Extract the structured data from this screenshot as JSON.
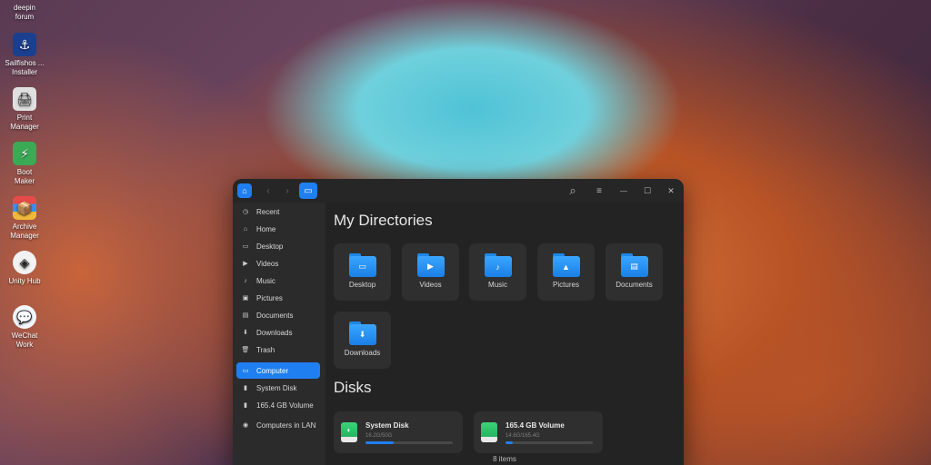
{
  "desktop": {
    "icons": [
      {
        "label": "deepin forum",
        "glyph": "💬"
      },
      {
        "label": "Sailfishos ... Installer",
        "glyph": "⚓"
      },
      {
        "label": "Print Manager",
        "glyph": "🖨"
      },
      {
        "label": "Boot Maker",
        "glyph": "⚡"
      },
      {
        "label": "Archive Manager",
        "glyph": "📦"
      },
      {
        "label": "Unity Hub",
        "glyph": "◈"
      },
      {
        "label": "WeChat Work",
        "glyph": "💬"
      }
    ]
  },
  "window": {
    "titlebar": {
      "back": "‹",
      "forward": "›",
      "view": "▭",
      "search": "⌕",
      "menu": "≡",
      "minimize": "—",
      "maximize": "☐",
      "close": "✕"
    },
    "sidebar": {
      "items": [
        {
          "label": "Recent",
          "glyph": "◷"
        },
        {
          "label": "Home",
          "glyph": "⌂"
        },
        {
          "label": "Desktop",
          "glyph": "▭"
        },
        {
          "label": "Videos",
          "glyph": "▶"
        },
        {
          "label": "Music",
          "glyph": "♪"
        },
        {
          "label": "Pictures",
          "glyph": "▣"
        },
        {
          "label": "Documents",
          "glyph": "▤"
        },
        {
          "label": "Downloads",
          "glyph": "⬇"
        },
        {
          "label": "Trash",
          "glyph": "🗑"
        }
      ],
      "devices": [
        {
          "label": "Computer",
          "glyph": "▭",
          "active": true
        },
        {
          "label": "System Disk",
          "glyph": "▮"
        },
        {
          "label": "165.4 GB Volume",
          "glyph": "▮"
        }
      ],
      "network": [
        {
          "label": "Computers in LAN",
          "glyph": "◉"
        }
      ]
    },
    "main": {
      "directories_title": "My Directories",
      "directories": [
        {
          "label": "Desktop",
          "glyph": "▭"
        },
        {
          "label": "Videos",
          "glyph": "▶"
        },
        {
          "label": "Music",
          "glyph": "♪"
        },
        {
          "label": "Pictures",
          "glyph": "▲"
        },
        {
          "label": "Documents",
          "glyph": "▤"
        },
        {
          "label": "Downloads",
          "glyph": "⬇"
        }
      ],
      "disks_title": "Disks",
      "disks": [
        {
          "name": "System Disk",
          "usage": "16.2G/50G",
          "fraction": 0.324,
          "glyph": "◐"
        },
        {
          "name": "165.4 GB Volume",
          "usage": "14.6G/165.4G",
          "fraction": 0.088,
          "glyph": ""
        }
      ],
      "status": "8 items"
    }
  }
}
